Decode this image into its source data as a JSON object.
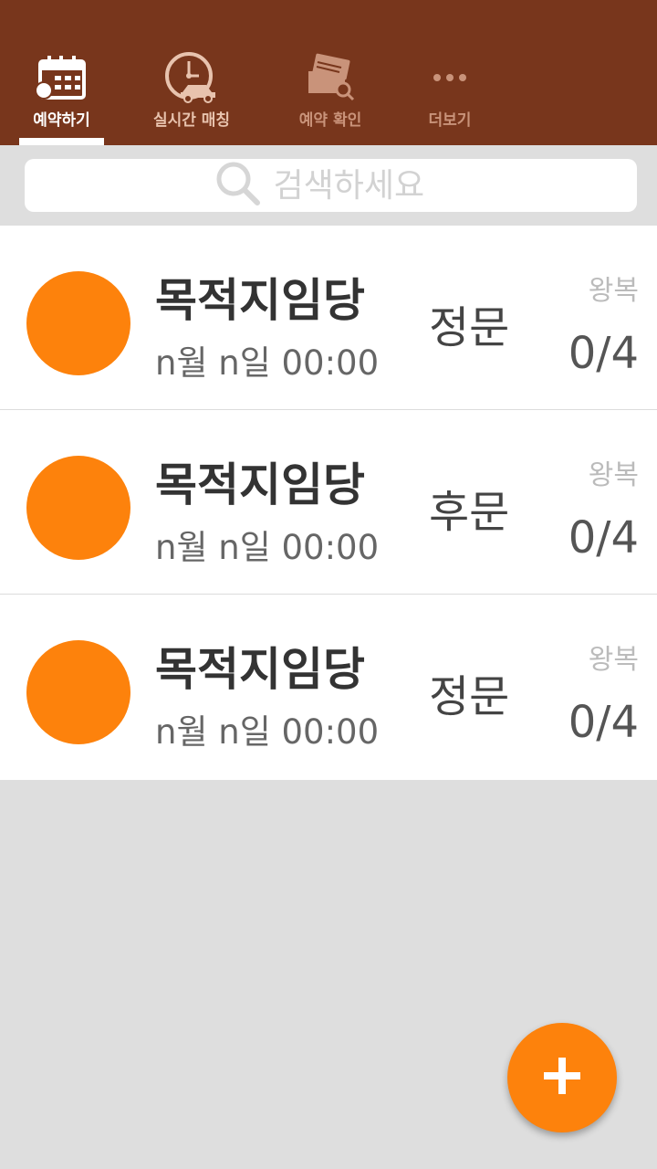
{
  "tabs": [
    {
      "label": "예약하기",
      "icon": "calendar-icon",
      "active": true
    },
    {
      "label": "실시간 매칭",
      "icon": "clock-car-icon",
      "active": false
    },
    {
      "label": "예약 확인",
      "icon": "ticket-search-icon",
      "active": false
    },
    {
      "label": "더보기",
      "icon": "more-dots-icon",
      "active": false
    }
  ],
  "search": {
    "placeholder": "검색하세요",
    "icon": "search-icon"
  },
  "reservations": [
    {
      "destination": "목적지임당",
      "datetime": "n월 n일 00:00",
      "gate": "정문",
      "trip_type": "왕복",
      "occupancy": "0/4"
    },
    {
      "destination": "목적지임당",
      "datetime": "n월 n일 00:00",
      "gate": "후문",
      "trip_type": "왕복",
      "occupancy": "0/4"
    },
    {
      "destination": "목적지임당",
      "datetime": "n월 n일 00:00",
      "gate": "정문",
      "trip_type": "왕복",
      "occupancy": "0/4"
    }
  ],
  "fab": {
    "icon": "plus-icon"
  },
  "colors": {
    "topbar": "#78361c",
    "accent": "#fd820c",
    "background": "#dedede"
  }
}
